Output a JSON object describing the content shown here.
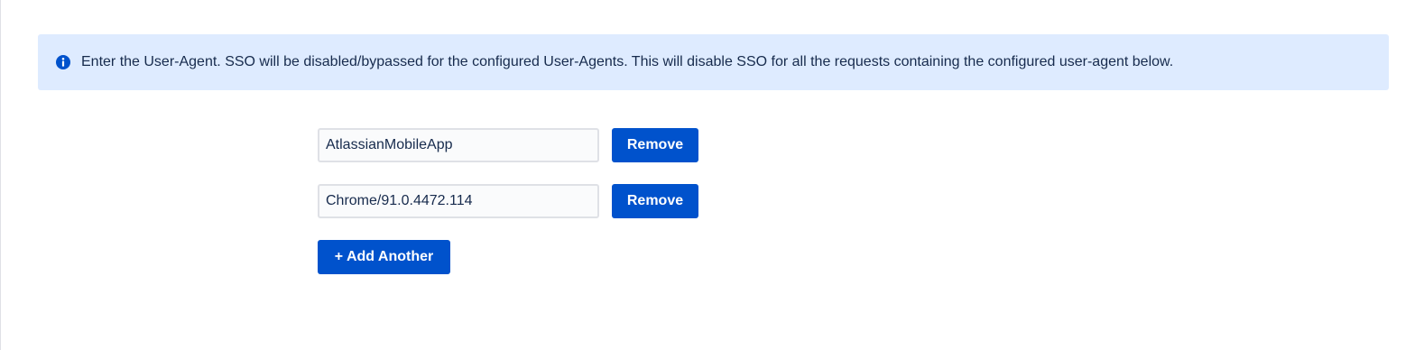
{
  "info_banner": {
    "icon": "info-icon",
    "text": "Enter the User-Agent. SSO will be disabled/bypassed for the configured User-Agents. This will disable SSO for all the requests containing the configured user-agent below."
  },
  "user_agents": [
    {
      "value": "AtlassianMobileApp",
      "remove_label": "Remove"
    },
    {
      "value": "Chrome/91.0.4472.114",
      "remove_label": "Remove"
    }
  ],
  "add_another_label": "+ Add Another",
  "colors": {
    "accent": "#0052cc",
    "banner_bg": "#deebff",
    "text": "#172b4d",
    "input_bg": "#fafbfc",
    "input_border": "#dfe1e6"
  }
}
